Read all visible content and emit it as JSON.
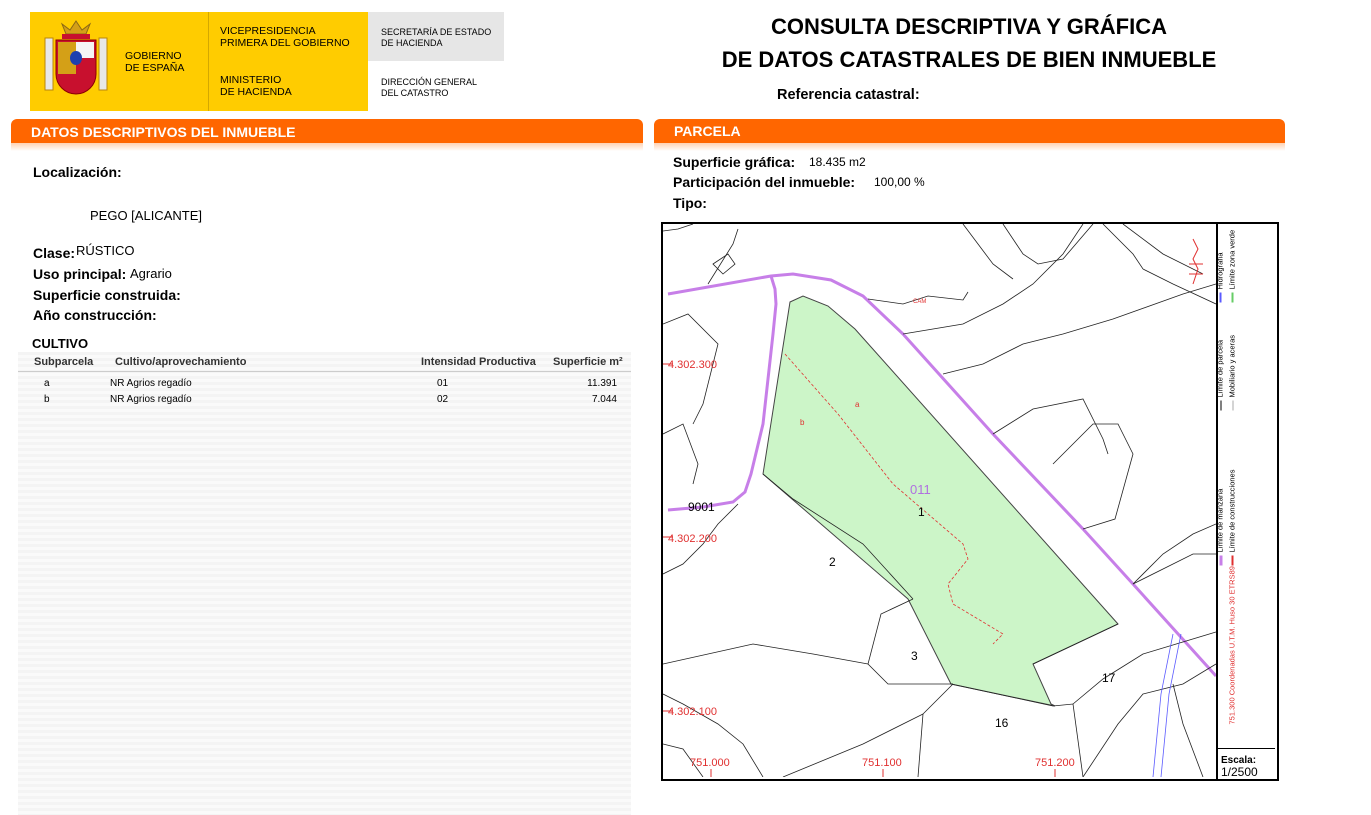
{
  "header": {
    "gov_line1": "GOBIERNO",
    "gov_line2": "DE ESPAÑA",
    "vp_line1": "VICEPRESIDENCIA",
    "vp_line2": "PRIMERA DEL GOBIERNO",
    "min_line1": "MINISTERIO",
    "min_line2": "DE HACIENDA",
    "sec_line1": "SECRETARÍA DE ESTADO",
    "sec_line2": "DE HACIENDA",
    "dir_line1": "DIRECCIÓN GENERAL",
    "dir_line2": "DEL CATASTRO",
    "title_line1": "CONSULTA DESCRIPTIVA Y GRÁFICA",
    "title_line2": "DE DATOS CATASTRALES DE BIEN INMUEBLE",
    "ref_label": "Referencia catastral:",
    "colors": {
      "brand_yellow": "#ffcc00",
      "accent_orange": "#ff6600"
    }
  },
  "descriptive": {
    "section_title": "DATOS DESCRIPTIVOS DEL INMUEBLE",
    "localizacion_label": "Localización:",
    "localizacion_value": "PEGO [ALICANTE]",
    "clase_label": "Clase:",
    "clase_value": "RÚSTICO",
    "uso_label": "Uso principal:",
    "uso_value": "Agrario",
    "sup_const_label": "Superficie construida:",
    "anio_label": "Año construcción:",
    "cultivo_title": "CULTIVO",
    "cultivo_headers": [
      "Subparcela",
      "Cultivo/aprovechamiento",
      "Intensidad Productiva",
      "Superficie m²"
    ],
    "cultivo_rows": [
      [
        "a",
        "NR Agrios regadío",
        "01",
        "11.391"
      ],
      [
        "b",
        "NR Agrios regadío",
        "02",
        "7.044"
      ]
    ]
  },
  "parcela": {
    "section_title": "PARCELA",
    "sup_label": "Superficie gráfica:",
    "sup_value": "18.435 m2",
    "part_label": "Participación del inmueble:",
    "part_value": "100,00 %",
    "tipo_label": "Tipo:"
  },
  "map": {
    "y_labels": [
      "4.302.300",
      "4.302.200",
      "4.302.100"
    ],
    "x_labels": [
      "751.000",
      "751.100",
      "751.200"
    ],
    "parcel_numbers": [
      "1",
      "2",
      "3",
      "16",
      "17"
    ],
    "parcel_code": "011",
    "polygon_label": "9001",
    "sub_a": "a",
    "sub_b": "b",
    "road_label": "CAM",
    "legend": {
      "manzana": "Límite de manzana",
      "parcela": "Límite de parcela",
      "hidrografia": "Hidrografía",
      "construcciones": "Límite de construcciones",
      "mobiliario": "Mobiliario y aceras",
      "zona_verde": "Límite zona verde",
      "coords": "751.300 Coordenadas U.T.M. Huso 30 ETRS89"
    },
    "scale_label": "Escala:",
    "scale_value": "1/2500"
  }
}
